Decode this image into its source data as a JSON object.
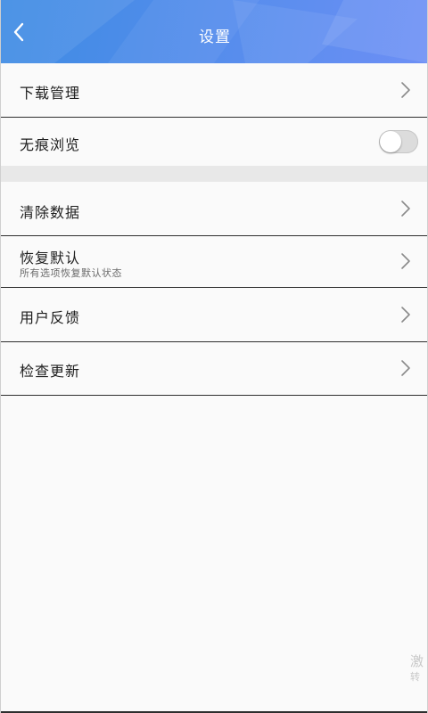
{
  "header": {
    "title": "设置",
    "back_icon": "chevron-left-icon",
    "gradient_start": "#3d8be3",
    "gradient_end": "#6d8ff5"
  },
  "settings": {
    "download": {
      "label": "下载管理"
    },
    "incognito": {
      "label": "无痕浏览",
      "enabled": false
    },
    "clear_data": {
      "label": "清除数据"
    },
    "restore_default": {
      "label": "恢复默认",
      "sublabel": "所有选项恢复默认状态"
    },
    "feedback": {
      "label": "用户反馈"
    },
    "check_update": {
      "label": "检查更新"
    }
  },
  "watermark": {
    "line1": "激",
    "line2": "转"
  }
}
